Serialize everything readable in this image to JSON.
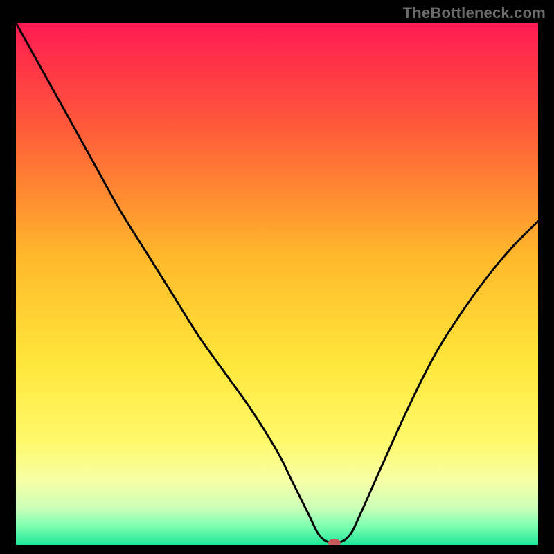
{
  "watermark": "TheBottleneck.com",
  "chart_data": {
    "type": "line",
    "title": "",
    "xlabel": "",
    "ylabel": "",
    "xlim": [
      0,
      100
    ],
    "ylim": [
      0,
      100
    ],
    "grid": false,
    "legend": false,
    "background_gradient": {
      "stops": [
        {
          "offset": 0.0,
          "color": "#ff1a52"
        },
        {
          "offset": 0.2,
          "color": "#ff5a3a"
        },
        {
          "offset": 0.45,
          "color": "#ffb92b"
        },
        {
          "offset": 0.65,
          "color": "#ffe63a"
        },
        {
          "offset": 0.8,
          "color": "#fff96a"
        },
        {
          "offset": 0.88,
          "color": "#f6ffa8"
        },
        {
          "offset": 0.93,
          "color": "#c9ffb8"
        },
        {
          "offset": 0.965,
          "color": "#7affb0"
        },
        {
          "offset": 1.0,
          "color": "#20e69a"
        }
      ]
    },
    "series": [
      {
        "name": "bottleneck-curve",
        "color": "#000000",
        "x": [
          0,
          5,
          10,
          15,
          20,
          25,
          30,
          35,
          40,
          45,
          50,
          53,
          56,
          58,
          60,
          62,
          64,
          66,
          70,
          75,
          80,
          85,
          90,
          95,
          100
        ],
        "y": [
          100,
          91,
          82,
          73,
          64,
          56,
          48,
          40,
          33,
          26,
          18,
          12,
          6,
          2,
          0.5,
          0.5,
          2,
          6,
          15,
          26,
          36,
          44,
          51,
          57,
          62
        ]
      }
    ],
    "marker": {
      "name": "current-point",
      "x": 61,
      "y": 0.4,
      "color": "#c45a5a",
      "rx": 9,
      "ry": 6
    },
    "annotations": []
  }
}
